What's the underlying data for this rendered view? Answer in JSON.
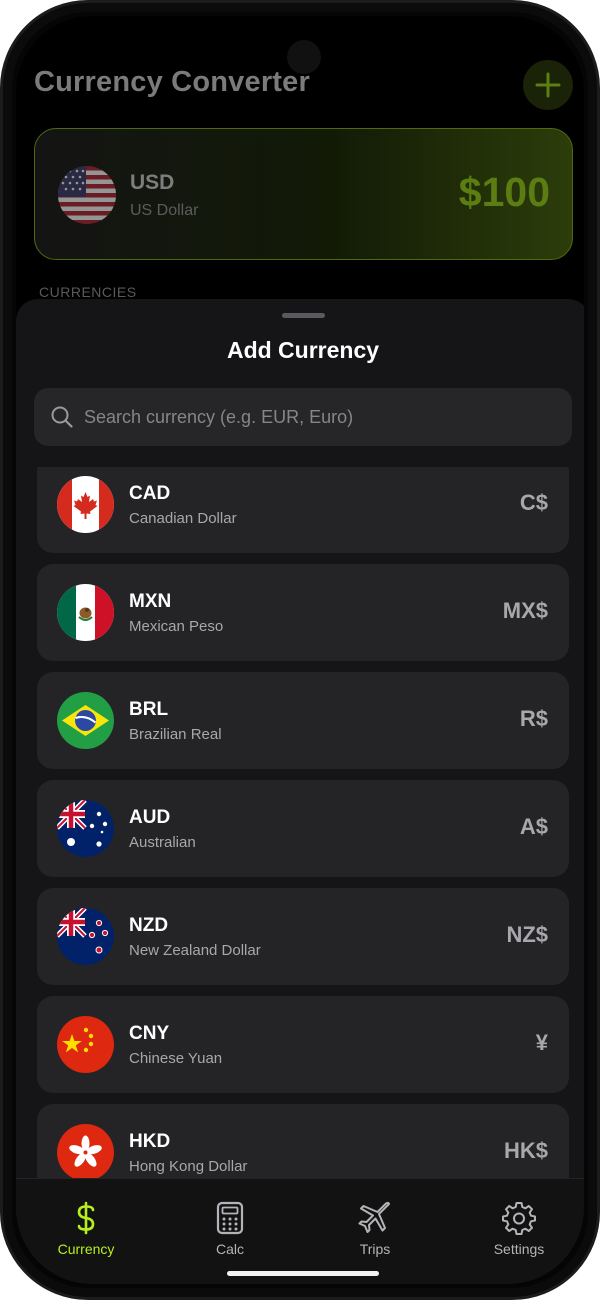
{
  "app": {
    "title": "Currency Converter",
    "add_icon": "plus-icon"
  },
  "base": {
    "code": "USD",
    "name": "US Dollar",
    "amount": "$100",
    "flag": "us-flag"
  },
  "section": {
    "label": "CURRENCIES"
  },
  "sheet": {
    "title": "Add Currency",
    "search": {
      "placeholder": "Search currency (e.g. EUR, Euro)",
      "value": ""
    },
    "currencies": [
      {
        "code": "CAD",
        "name": "Canadian Dollar",
        "symbol": "C$",
        "flag": "canada-flag"
      },
      {
        "code": "MXN",
        "name": "Mexican Peso",
        "symbol": "MX$",
        "flag": "mexico-flag"
      },
      {
        "code": "BRL",
        "name": "Brazilian Real",
        "symbol": "R$",
        "flag": "brazil-flag"
      },
      {
        "code": "AUD",
        "name": "Australian",
        "symbol": "A$",
        "flag": "australia-flag"
      },
      {
        "code": "NZD",
        "name": "New Zealand Dollar",
        "symbol": "NZ$",
        "flag": "new-zealand-flag"
      },
      {
        "code": "CNY",
        "name": "Chinese Yuan",
        "symbol": "¥",
        "flag": "china-flag"
      },
      {
        "code": "HKD",
        "name": "Hong Kong Dollar",
        "symbol": "HK$",
        "flag": "hong-kong-flag"
      }
    ]
  },
  "tabs": [
    {
      "label": "Currency",
      "icon": "dollar-icon",
      "active": true
    },
    {
      "label": "Calc",
      "icon": "calculator-icon",
      "active": false
    },
    {
      "label": "Trips",
      "icon": "airplane-icon",
      "active": false
    },
    {
      "label": "Settings",
      "icon": "gear-icon",
      "active": false
    }
  ],
  "colors": {
    "accent": "#b6f01c",
    "sheet": "#151517",
    "row": "#242426"
  }
}
